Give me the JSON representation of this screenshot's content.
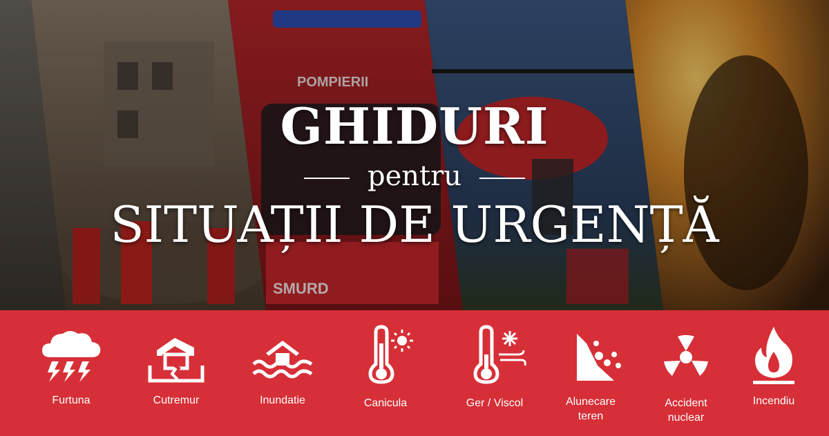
{
  "headline": {
    "title": "GHIDURI",
    "connector": "pentru",
    "subtitle": "SITUAȚII DE URGENȚĂ"
  },
  "photos": {
    "ambulance_text_top": "POMPIERII",
    "ambulance_text_bottom": "SMURD"
  },
  "colors": {
    "band": "#d62f37",
    "text": "#ffffff"
  },
  "hazards": [
    {
      "label": "Furtuna",
      "icon": "storm-cloud-icon"
    },
    {
      "label": "Cutremur",
      "icon": "earthquake-house-icon"
    },
    {
      "label": "Inundatie",
      "icon": "flooded-house-icon"
    },
    {
      "label": "Canicula",
      "icon": "thermometer-sun-icon"
    },
    {
      "label": "Ger / Viscol",
      "icon": "thermometer-snow-icon"
    },
    {
      "label": "Alunecare teren",
      "icon": "landslide-icon"
    },
    {
      "label": "Accident nuclear",
      "icon": "radiation-icon"
    },
    {
      "label": "Incendiu",
      "icon": "fire-icon"
    }
  ]
}
